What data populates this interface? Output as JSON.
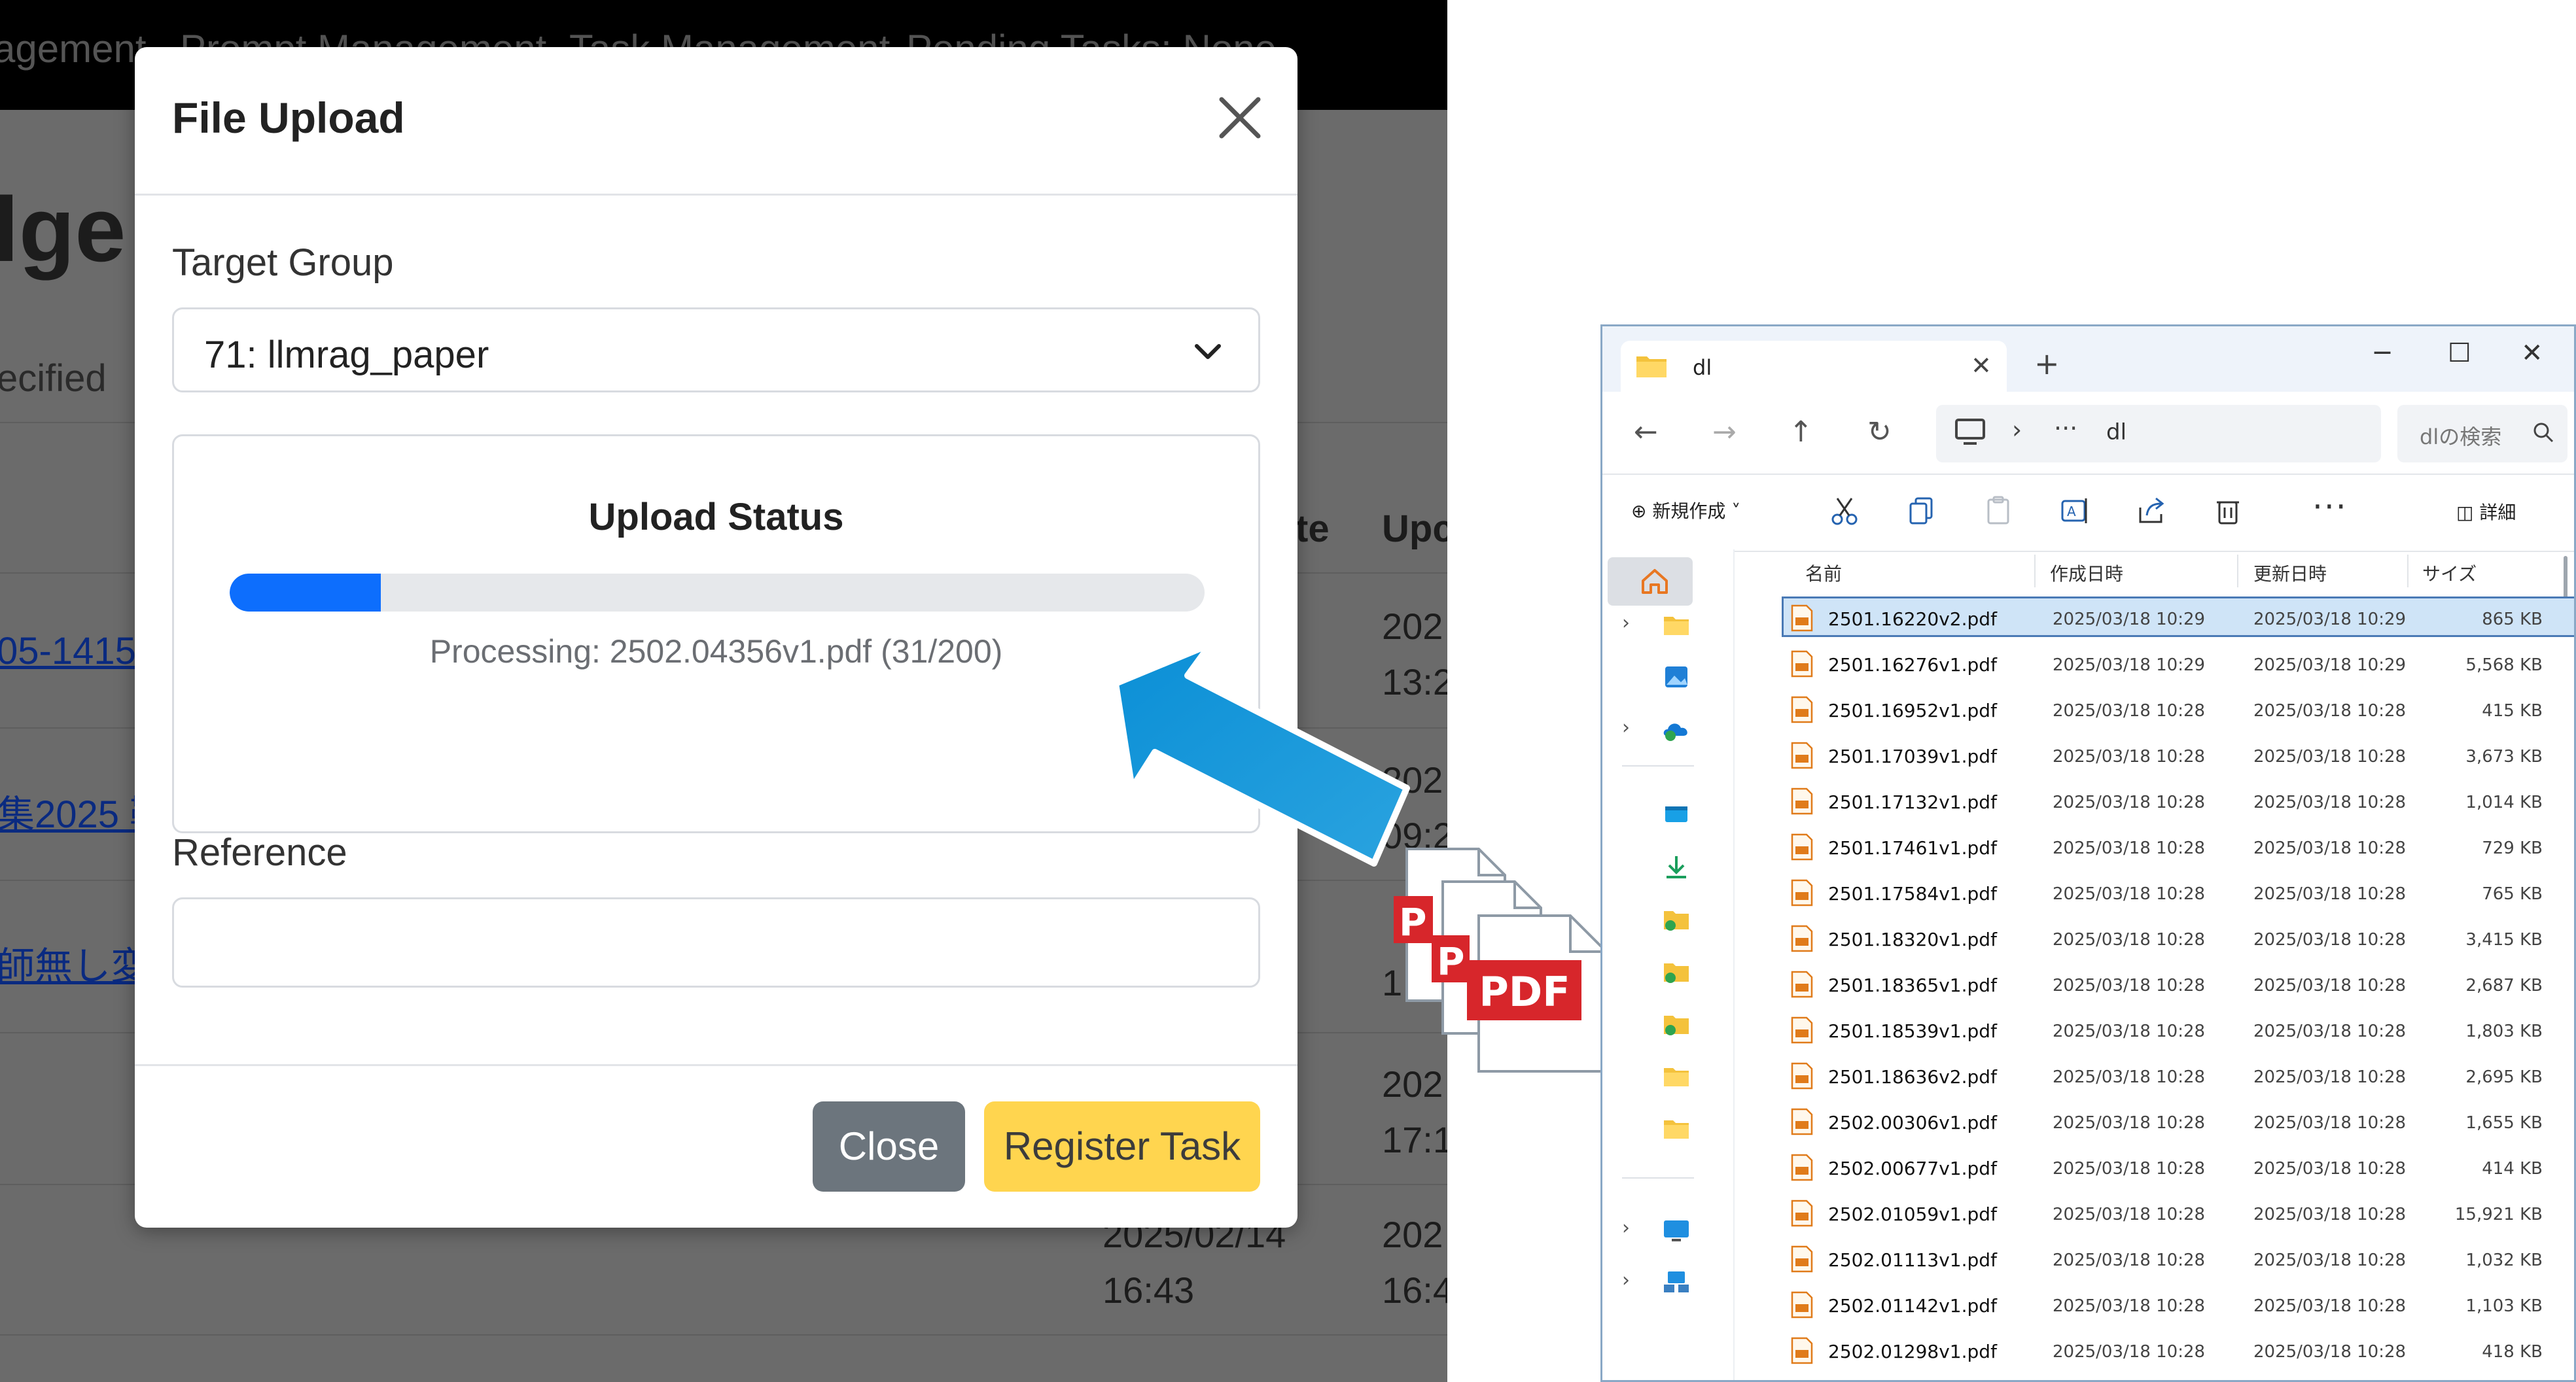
{
  "background_app": {
    "nav_items": [
      "agement",
      "Prompt Management",
      "Task Management",
      "Pending Tasks: None"
    ],
    "heading_fragment": "lge",
    "subtext_fragment": "ecified",
    "col_fragment_1": "te",
    "col_fragment_2": "Upc",
    "links": [
      "05-1415",
      "集2025 鞍",
      "師無し変"
    ],
    "dates": [
      "202",
      "13:2",
      "202",
      "09:2",
      "1",
      "202",
      "17:1",
      "2025/02/14",
      "16:43",
      "202",
      "16:4"
    ]
  },
  "modal": {
    "title": "File Upload",
    "target_group_label": "Target Group",
    "target_group_value": "71: llmrag_paper",
    "upload_status_title": "Upload Status",
    "progress_fraction": 0.155,
    "progress_text": "Processing: 2502.04356v1.pdf (31/200)",
    "reference_label": "Reference",
    "reference_value": "",
    "close_button": "Close",
    "register_button": "Register Task",
    "colors": {
      "progress": "#0d6efd",
      "close_btn": "#6c757d",
      "register_btn": "#ffd54f"
    }
  },
  "overlay": {
    "arrow_color": "#1a9ad9",
    "pdf_label": "PDF"
  },
  "explorer": {
    "tab_title": "dl",
    "address_path": "dl",
    "search_placeholder": "dlの検索",
    "toolbar_new": "新規作成",
    "toolbar_details": "詳細",
    "columns": {
      "name": "名前",
      "created": "作成日時",
      "modified": "更新日時",
      "size": "サイズ"
    },
    "files": [
      {
        "name": "2501.16220v2.pdf",
        "created": "2025/03/18 10:29",
        "modified": "2025/03/18 10:29",
        "size": "865 KB",
        "selected": true
      },
      {
        "name": "2501.16276v1.pdf",
        "created": "2025/03/18 10:29",
        "modified": "2025/03/18 10:29",
        "size": "5,568 KB"
      },
      {
        "name": "2501.16952v1.pdf",
        "created": "2025/03/18 10:28",
        "modified": "2025/03/18 10:28",
        "size": "415 KB"
      },
      {
        "name": "2501.17039v1.pdf",
        "created": "2025/03/18 10:28",
        "modified": "2025/03/18 10:28",
        "size": "3,673 KB"
      },
      {
        "name": "2501.17132v1.pdf",
        "created": "2025/03/18 10:28",
        "modified": "2025/03/18 10:28",
        "size": "1,014 KB"
      },
      {
        "name": "2501.17461v1.pdf",
        "created": "2025/03/18 10:28",
        "modified": "2025/03/18 10:28",
        "size": "729 KB"
      },
      {
        "name": "2501.17584v1.pdf",
        "created": "2025/03/18 10:28",
        "modified": "2025/03/18 10:28",
        "size": "765 KB"
      },
      {
        "name": "2501.18320v1.pdf",
        "created": "2025/03/18 10:28",
        "modified": "2025/03/18 10:28",
        "size": "3,415 KB"
      },
      {
        "name": "2501.18365v1.pdf",
        "created": "2025/03/18 10:28",
        "modified": "2025/03/18 10:28",
        "size": "2,687 KB"
      },
      {
        "name": "2501.18539v1.pdf",
        "created": "2025/03/18 10:28",
        "modified": "2025/03/18 10:28",
        "size": "1,803 KB"
      },
      {
        "name": "2501.18636v2.pdf",
        "created": "2025/03/18 10:28",
        "modified": "2025/03/18 10:28",
        "size": "2,695 KB"
      },
      {
        "name": "2502.00306v1.pdf",
        "created": "2025/03/18 10:28",
        "modified": "2025/03/18 10:28",
        "size": "1,655 KB"
      },
      {
        "name": "2502.00677v1.pdf",
        "created": "2025/03/18 10:28",
        "modified": "2025/03/18 10:28",
        "size": "414 KB"
      },
      {
        "name": "2502.01059v1.pdf",
        "created": "2025/03/18 10:28",
        "modified": "2025/03/18 10:28",
        "size": "15,921 KB"
      },
      {
        "name": "2502.01113v1.pdf",
        "created": "2025/03/18 10:28",
        "modified": "2025/03/18 10:28",
        "size": "1,032 KB"
      },
      {
        "name": "2502.01142v1.pdf",
        "created": "2025/03/18 10:28",
        "modified": "2025/03/18 10:28",
        "size": "1,103 KB"
      },
      {
        "name": "2502.01298v1.pdf",
        "created": "2025/03/18 10:28",
        "modified": "2025/03/18 10:28",
        "size": "418 KB"
      }
    ],
    "nav_items": [
      {
        "icon": "folder-icon",
        "chevron": true
      },
      {
        "icon": "gallery-icon",
        "chevron": false
      },
      {
        "icon": "onedrive-icon",
        "chevron": true
      },
      {
        "icon": "desktop-folder-icon",
        "chevron": false
      },
      {
        "icon": "download-icon",
        "chevron": false
      },
      {
        "icon": "synced-folder-icon",
        "chevron": false
      },
      {
        "icon": "synced-folder-icon",
        "chevron": false
      },
      {
        "icon": "synced-folder-icon",
        "chevron": false
      },
      {
        "icon": "folder-icon",
        "chevron": false
      },
      {
        "icon": "folder-icon",
        "chevron": false
      },
      {
        "icon": "this-pc-icon",
        "chevron": true
      },
      {
        "icon": "network-icon",
        "chevron": true
      }
    ]
  }
}
